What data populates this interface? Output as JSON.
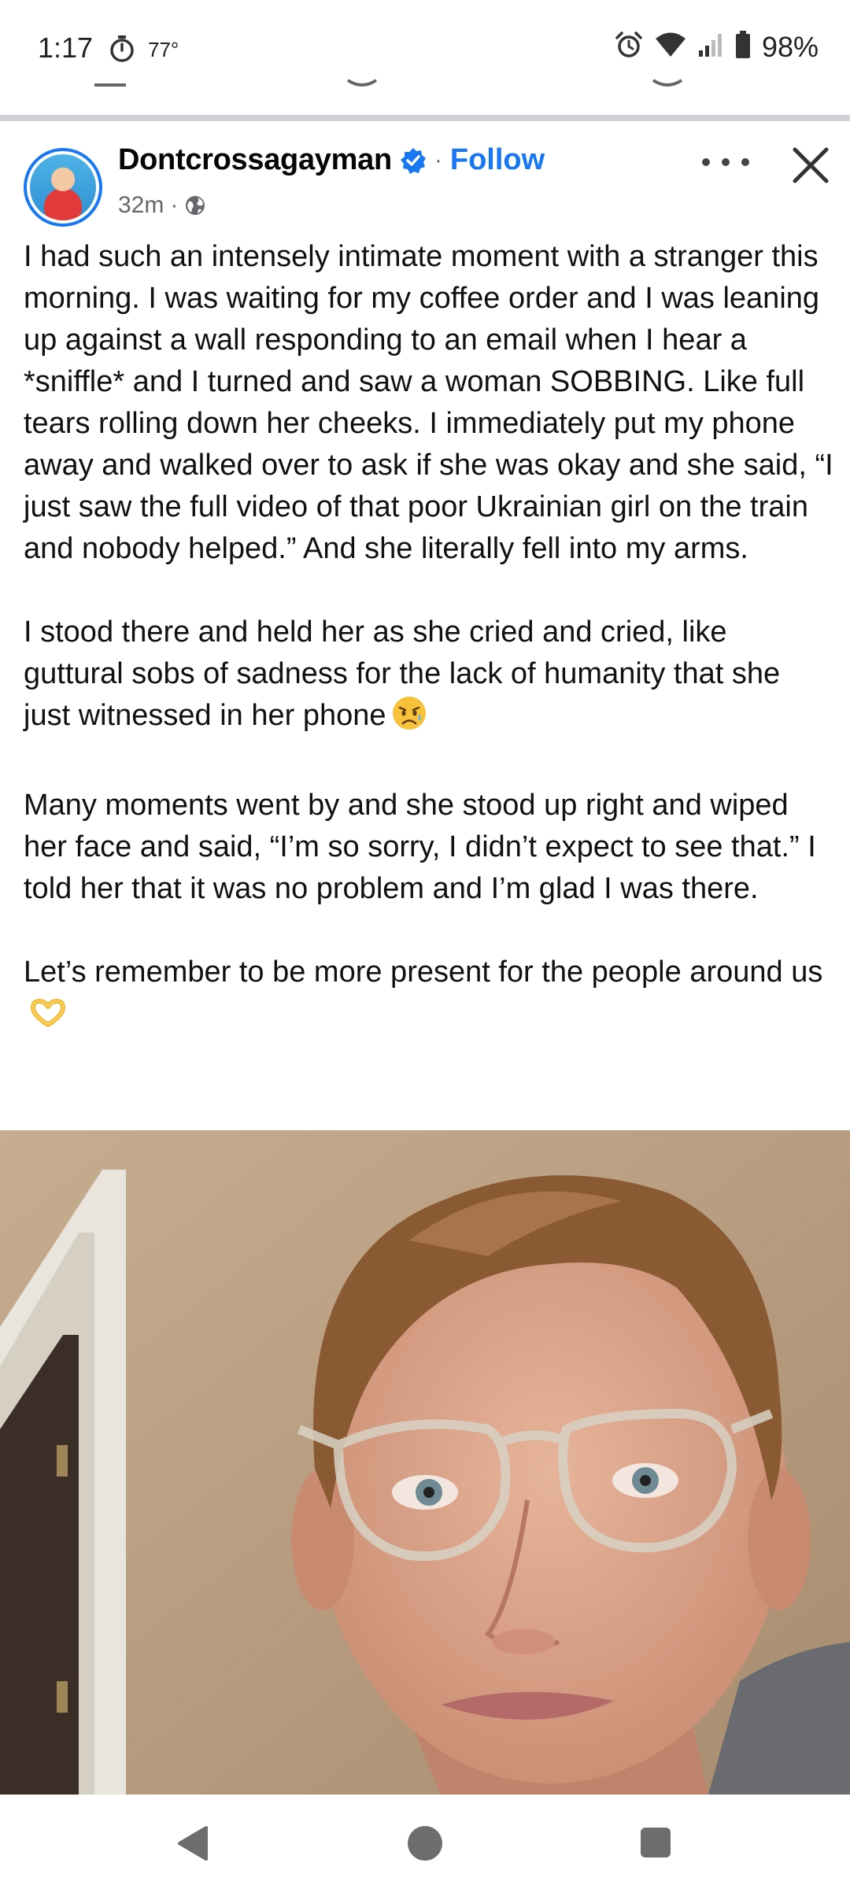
{
  "status_bar": {
    "time": "1:17",
    "temperature": "77°",
    "battery": "98%",
    "icons": [
      "timer-icon",
      "alarm-icon",
      "wifi-icon",
      "signal-icon",
      "battery-icon"
    ]
  },
  "post": {
    "author": "Dontcrossagayman",
    "verified": true,
    "separator": "·",
    "follow_label": "Follow",
    "time_ago": "32m",
    "meta_separator": "·",
    "audience_icon": "globe-icon",
    "paragraphs": [
      "I had such an intensely intimate moment with a stranger this morning. I was waiting for my coffee order and I was leaning up against a wall responding to an email when I hear a *sniffle* and I turned and saw a woman SOBBING. Like full tears rolling down her cheeks. I immediately put my phone away and walked over to ask if she was okay and she said, “I just saw the full video of that poor Ukrainian girl on the train and nobody helped.” And she literally fell into my arms.",
      "I stood there and held her as she cried and cried, like guttural sobs of sadness for the lack of humanity that she just witnessed in her phone",
      "Many moments went by and she stood up right and wiped her face and said, “I’m so sorry, I didn’t expect to see that.” I told her that it was no problem and I’m glad I was there.",
      "Let’s remember to be more present for the people around us"
    ],
    "emoji_sad": "sad-but-relieved-face-emoji",
    "emoji_heart_hands": "heart-hands-emoji",
    "photo": "selfie-photo"
  },
  "colors": {
    "accent": "#1877f2",
    "muted": "#65676b",
    "divider": "#cfd2d6"
  }
}
